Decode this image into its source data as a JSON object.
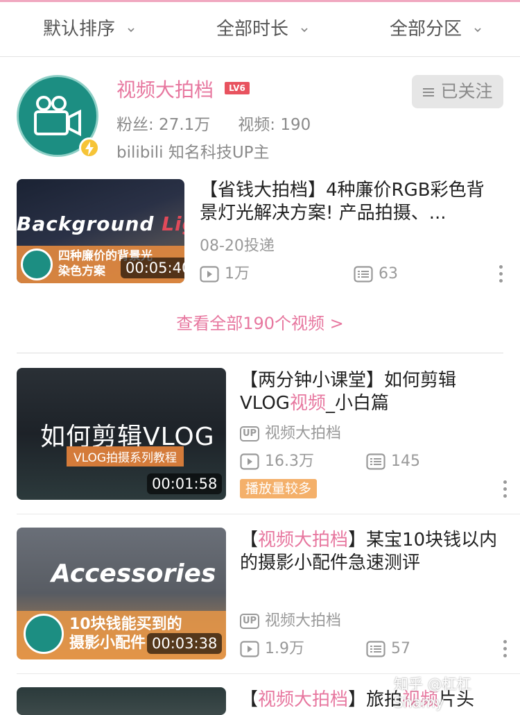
{
  "filters": {
    "sort": "默认排序",
    "duration": "全部时长",
    "zone": "全部分区"
  },
  "uploader": {
    "name": "视频大拍档",
    "level": "LV6",
    "fans": "粉丝: 27.1万",
    "videos": "视频: 190",
    "certification": "bilibili 知名科技UP主",
    "follow_label": "已关注"
  },
  "featured": {
    "title": "【省钱大拍档】4种廉价RGB彩色背景灯光解决方案! 产品拍摄、...",
    "date": "08-20投递",
    "plays": "1万",
    "danmaku": "63",
    "duration": "00:05:40",
    "thumb_text": "Background",
    "thumb_text_accent": "Light",
    "thumb_caption_1": "四种廉价的背景光",
    "thumb_caption_2": "染色方案"
  },
  "view_all": "查看全部190个视频 >",
  "videos": [
    {
      "title_a": "【两分钟小课堂】如何剪辑VLOG",
      "title_pink": "视频",
      "title_b": "_小白篇",
      "up": "视频大拍档",
      "plays": "16.3万",
      "danmaku": "145",
      "tag": "播放量较多",
      "duration": "00:01:58",
      "thumb_text": "如何剪辑VLOG",
      "thumb_band": "VLOG拍摄系列教程"
    },
    {
      "title_a": "【",
      "title_pink": "视频大拍档",
      "title_b": "】某宝10块钱以内的摄影小配件急速测评",
      "up": "视频大拍档",
      "plays": "1.9万",
      "danmaku": "57",
      "duration": "00:03:38",
      "thumb_text": "Accessories",
      "thumb_caption_1": "10块钱能买到的",
      "thumb_caption_2": "摄影小配件"
    },
    {
      "title_a": "【",
      "title_pink": "视频大拍档",
      "title_b": "】旅拍",
      "title_pink2": "视频",
      "title_c": "片头"
    }
  ],
  "watermark": "知乎 @杠杠Shamy",
  "colors": {
    "accent": "#e7779f",
    "teal": "#1c8e82",
    "tag": "#f4b06a",
    "level": "#e8535f"
  }
}
